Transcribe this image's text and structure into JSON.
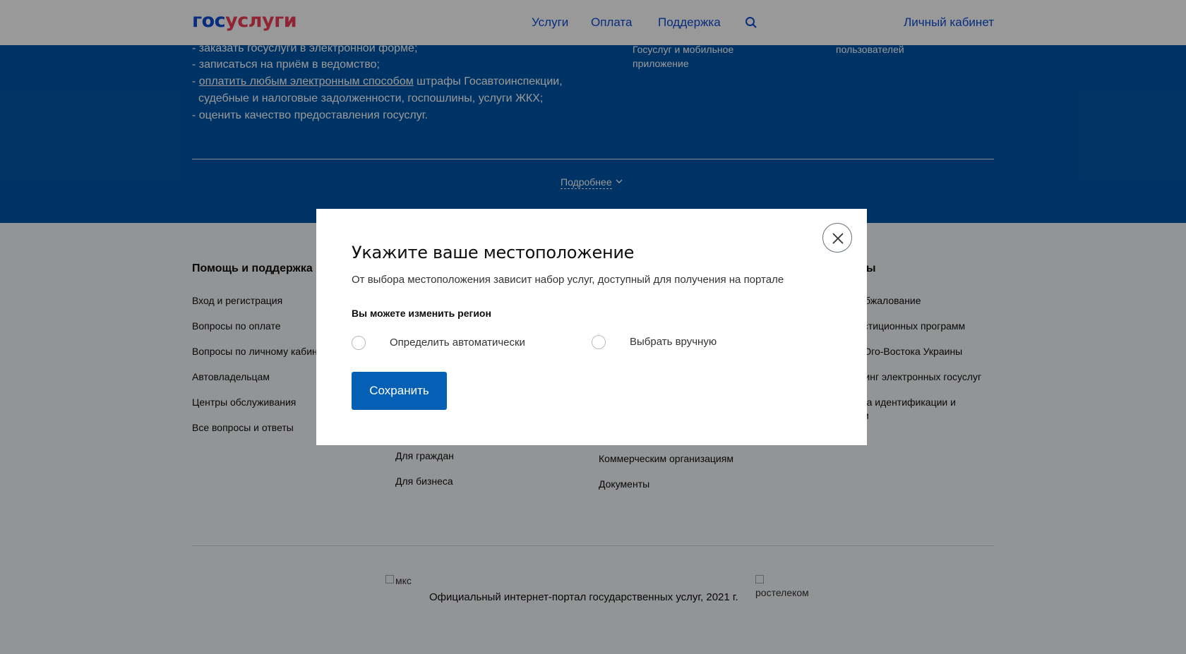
{
  "header": {
    "logo_part1": "гос",
    "logo_part2": "услуги",
    "nav": [
      "Услуги",
      "Оплата",
      "Поддержка"
    ],
    "search_icon": "search-icon",
    "personal_account": "Личный кабинет"
  },
  "info": {
    "line1": "- заказать госуслуги в электронной форме;",
    "line2": "- записаться на приём в ведомство;",
    "line3_prefix": "- ",
    "line3_link": "оплатить любым электронным способом",
    "line3_suffix": " штрафы Госавтоинспекции,",
    "line4": "судебные и налоговые задолженности, госпошлины, услуги ЖКХ;",
    "line5": "- оценить качество предоставления госуслуг.",
    "side1_line1": "Госуслуг и мобильное",
    "side1_line2": "приложение",
    "side2_line1": "пользователей",
    "more": "Подробнее"
  },
  "footer": {
    "col1_title": "Помощь и поддержка",
    "col1_links": [
      "Вход и регистрация",
      "Вопросы по оплате",
      "Вопросы по личному кабин",
      "Автовладельцам",
      "Центры обслуживания",
      "Все вопросы и ответы"
    ],
    "col2_links": [
      "Для граждан",
      "Для бизнеса"
    ],
    "col3_links": [
      "Коммерческим организациям",
      "Документы"
    ],
    "col4_title": "кты",
    "col4_links": [
      "бжалование",
      "естиционных программ",
      "Юго-Востока Украины",
      "тинг электронных госуслуг",
      "ма идентификации и",
      "ии"
    ],
    "logo1_alt": "мкс",
    "logo2_alt_line1": "",
    "logo2_alt_line2": "ростелеком",
    "copyright": "Официальный интернет-портал государственных услуг, 2021 г."
  },
  "modal": {
    "title": "Укажите ваше местоположение",
    "description": "От выбора местоположения зависит набор услуг, доступный для получения на портале",
    "subtitle": "Вы можете изменить регион",
    "option_auto": "Определить автоматически",
    "option_manual": "Выбрать вручную",
    "save_label": "Сохранить",
    "close_icon": "close-icon"
  },
  "colors": {
    "brand_blue": "#0d4cd3",
    "brand_red": "#ee3f58",
    "info_band": "#0056a8",
    "button": "#0560b5"
  }
}
